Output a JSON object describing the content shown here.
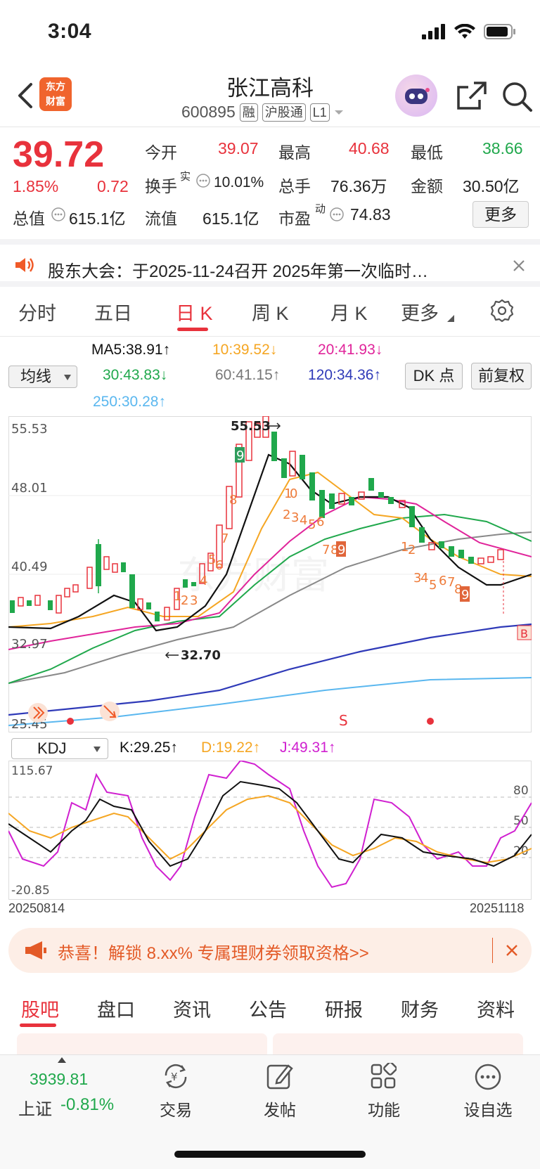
{
  "status": {
    "time": "3:04"
  },
  "header": {
    "logo_line1": "东方",
    "logo_line2": "财富",
    "stock_name": "张江高科",
    "stock_code": "600895",
    "tags": [
      "融",
      "沪股通",
      "L1"
    ]
  },
  "quote": {
    "price": "39.72",
    "change_pct": "1.85%",
    "change": "0.72",
    "total_cap_label": "总值",
    "total_cap": "615.1亿",
    "open_label": "今开",
    "open": "39.07",
    "high_label": "最高",
    "high": "40.68",
    "low_label": "最低",
    "low": "38.66",
    "turnover_label": "换手",
    "turnover_sup": "实",
    "turnover": "10.01%",
    "volume_label": "总手",
    "volume": "76.36万",
    "amount_label": "金额",
    "amount": "30.50亿",
    "float_cap_label": "流值",
    "float_cap": "615.1亿",
    "pe_label": "市盈",
    "pe_sup": "动",
    "pe": "74.83",
    "more_label": "更多"
  },
  "notice": {
    "text": "股东大会：于2025-11-24召开 2025年第一次临时…"
  },
  "period_tabs": [
    "分时",
    "五日",
    "日 K",
    "周 K",
    "月 K",
    "更多"
  ],
  "ma": {
    "selector": "均线",
    "ma5": "MA5:38.91",
    "ma5_arrow": "↑",
    "ma10": "10:39.52",
    "ma10_arrow": "↓",
    "ma20": "20:41.93",
    "ma20_arrow": "↓",
    "ma30": "30:43.83",
    "ma30_arrow": "↓",
    "ma60": "60:41.15",
    "ma60_arrow": "↑",
    "ma120": "120:34.36",
    "ma120_arrow": "↑",
    "ma250": "250:30.28",
    "ma250_arrow": "↑",
    "dk_label": "DK 点",
    "fq_label": "前复权"
  },
  "chart": {
    "y_labels": [
      "55.53",
      "48.01",
      "40.49",
      "32.97",
      "25.45"
    ],
    "high_mark": "55.53",
    "low_mark": "32.70",
    "s_mark": "S",
    "b_mark": "B"
  },
  "kdj": {
    "selector": "KDJ",
    "k": "K:29.25",
    "k_arrow": "↑",
    "d": "D:19.22",
    "d_arrow": "↑",
    "j": "J:49.31",
    "j_arrow": "↑",
    "y_top": "115.67",
    "y_bottom": "-20.85",
    "ref_levels": [
      "80",
      "50",
      "20"
    ],
    "date_start": "20250814",
    "date_end": "20251118"
  },
  "colors": {
    "up": "#e8323c",
    "down": "#20a84c",
    "accent": "#e8323c"
  },
  "promo": {
    "text": "恭喜！解锁 8.xx% 专属理财券领取资格>>"
  },
  "bottom_tabs": [
    "股吧",
    "盘口",
    "资讯",
    "公告",
    "研报",
    "财务",
    "资料"
  ],
  "bottom_nav": {
    "index_value": "3939.81",
    "index_label": "上证",
    "index_change": "-0.81%",
    "trade": "交易",
    "post": "发帖",
    "func": "功能",
    "watch": "设自选"
  }
}
